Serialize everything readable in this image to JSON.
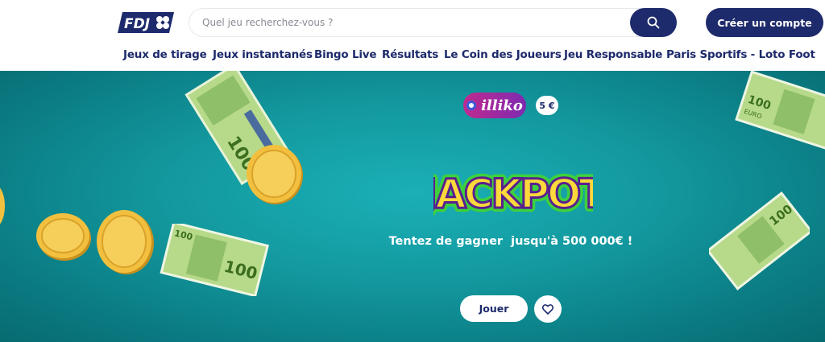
{
  "header": {
    "logo_text": "FDJ",
    "search": {
      "placeholder": "Quel jeu recherchez-vous ?",
      "value": "",
      "icon": "search-icon"
    },
    "cta_label": "Créer un compte"
  },
  "nav": {
    "items": [
      {
        "label": "Jeux de tirage"
      },
      {
        "label": "Jeux instantanés"
      },
      {
        "label": "Bingo Live"
      },
      {
        "label": "Résultats"
      },
      {
        "label": "Le Coin des Joueurs"
      },
      {
        "label": "Jeu Responsable"
      },
      {
        "label": "Paris Sportifs - Loto Foot"
      }
    ]
  },
  "hero": {
    "brand": "illiko",
    "price": "5 €",
    "game_title": "JACKPOT",
    "tagline": "Tentez de gagner  jusqu'à 500 000€ !",
    "play_label": "Jouer",
    "favorite_icon": "heart-icon",
    "banknote_denomination": "100",
    "banknote_currency": "EURO"
  },
  "colors": {
    "brand_navy": "#1d2a6b",
    "hero_teal": "#139aa0",
    "illiko_pink": "#c02a8f",
    "illiko_purple": "#7d2bb0",
    "jackpot_yellow": "#ffd93b",
    "jackpot_green": "#3dd13d"
  }
}
